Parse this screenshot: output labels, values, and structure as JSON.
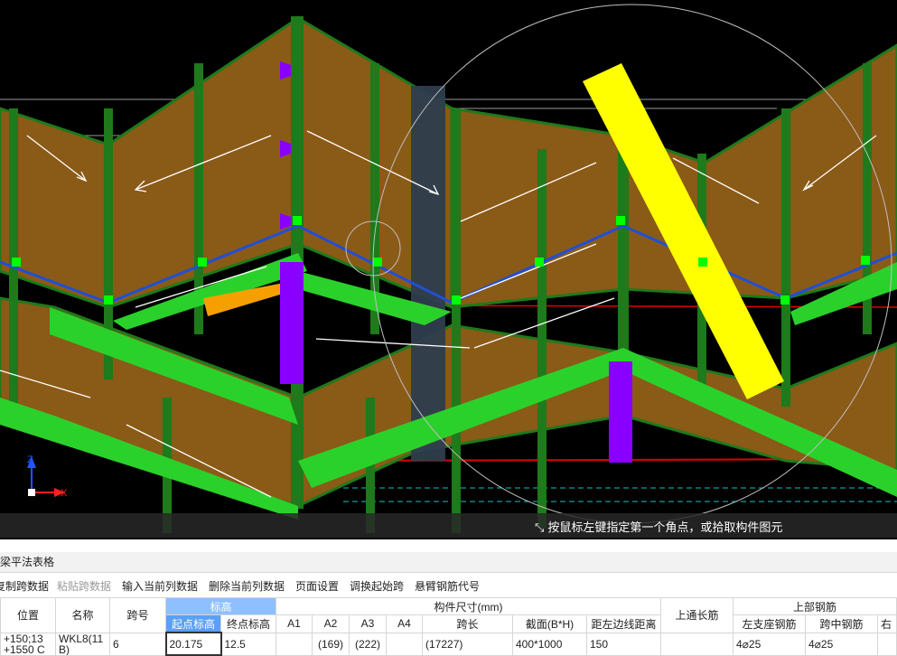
{
  "canvas": {
    "status_hint": "按鼠标左键指定第一个角点，或拾取构件图元",
    "axis_labels": {
      "z": "Z",
      "x": "X"
    },
    "colors": {
      "background": "#000000",
      "wall": "#8a5a17",
      "column": "#1e7a1a",
      "beam": "#2bd12b",
      "highlight": "#ffff00",
      "purple": "#8a00ff",
      "blue_line": "#1f4fd6"
    }
  },
  "panel": {
    "title": "梁平法表格",
    "toolbar": [
      {
        "label": "复制跨数据",
        "enabled": true
      },
      {
        "label": "粘贴跨数据",
        "enabled": false
      },
      {
        "label": "输入当前列数据",
        "enabled": true
      },
      {
        "label": "删除当前列数据",
        "enabled": true
      },
      {
        "label": "页面设置",
        "enabled": true
      },
      {
        "label": "调换起始跨",
        "enabled": true
      },
      {
        "label": "悬臂钢筋代号",
        "enabled": true
      }
    ],
    "headers": {
      "position": "位置",
      "name": "名称",
      "span": "跨号",
      "elevation_group": "标高",
      "start_elev": "起点标高",
      "end_elev": "终点标高",
      "size_group": "构件尺寸(mm)",
      "a1": "A1",
      "a2": "A2",
      "a3": "A3",
      "a4": "A4",
      "span_length": "跨长",
      "section": "截面(B*H)",
      "edge_dist": "距左边线距离",
      "top_through": "上通长筋",
      "upper_group": "上部钢筋",
      "left_support": "左支座钢筋",
      "mid_span": "跨中钢筋",
      "right_cut": "右"
    },
    "row": {
      "position": "+150;13",
      "position_2": "+1550 C",
      "name_line1": "WKL8(11",
      "name_line2": "B)",
      "span": "6",
      "start_elev": "20.175",
      "end_elev": "12.5",
      "a1": "",
      "a2": "(169)",
      "a3": "(222)",
      "a4": "",
      "span_length": "(17227)",
      "section": "400*1000",
      "edge_dist": "150",
      "top_through": "",
      "left_support": "4⌀25",
      "mid_span": "4⌀25"
    }
  }
}
